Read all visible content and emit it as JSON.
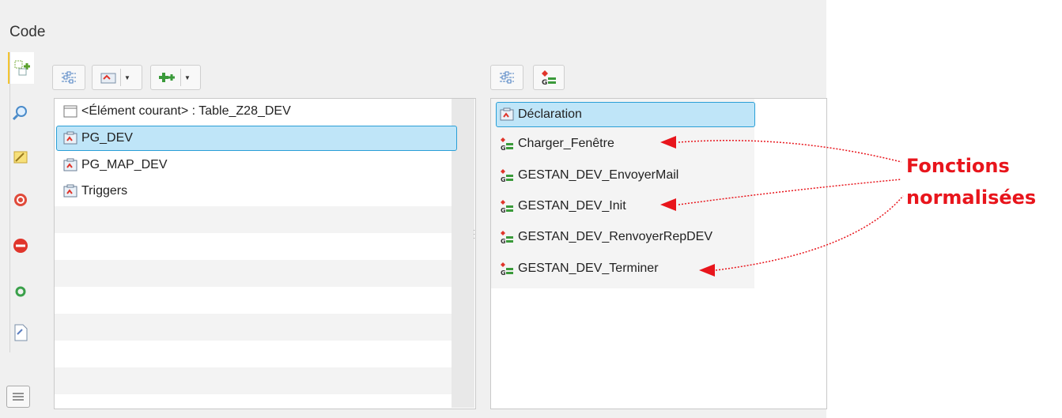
{
  "window": {
    "title": "Code"
  },
  "left_toolbar": [
    {
      "name": "new-element"
    },
    {
      "name": "search"
    },
    {
      "name": "pencil"
    },
    {
      "name": "stop"
    },
    {
      "name": "minus"
    },
    {
      "name": "refresh"
    },
    {
      "name": "document"
    }
  ],
  "left_list": {
    "items": [
      {
        "label": "<Élément courant> : Table_Z28_DEV",
        "icon": "window-icon"
      },
      {
        "label": "PG_DEV",
        "icon": "procedures-icon",
        "selected": true
      },
      {
        "label": "PG_MAP_DEV",
        "icon": "procedures-icon"
      },
      {
        "label": "Triggers",
        "icon": "procedures-icon"
      }
    ]
  },
  "right_list": {
    "items": [
      {
        "label": "Déclaration",
        "icon": "procedures-icon",
        "selected": true
      },
      {
        "label": "Charger_Fenêtre",
        "icon": "global-procedure-icon"
      },
      {
        "label": "GESTAN_DEV_EnvoyerMail",
        "icon": "global-procedure-icon"
      },
      {
        "label": "GESTAN_DEV_Init",
        "icon": "global-procedure-icon"
      },
      {
        "label": "GESTAN_DEV_RenvoyerRepDEV",
        "icon": "global-procedure-icon"
      },
      {
        "label": "GESTAN_DEV_Terminer",
        "icon": "global-procedure-icon"
      }
    ]
  },
  "annotation": {
    "line1": "Fonctions",
    "line2": "normalisées",
    "color": "#e8151c"
  }
}
